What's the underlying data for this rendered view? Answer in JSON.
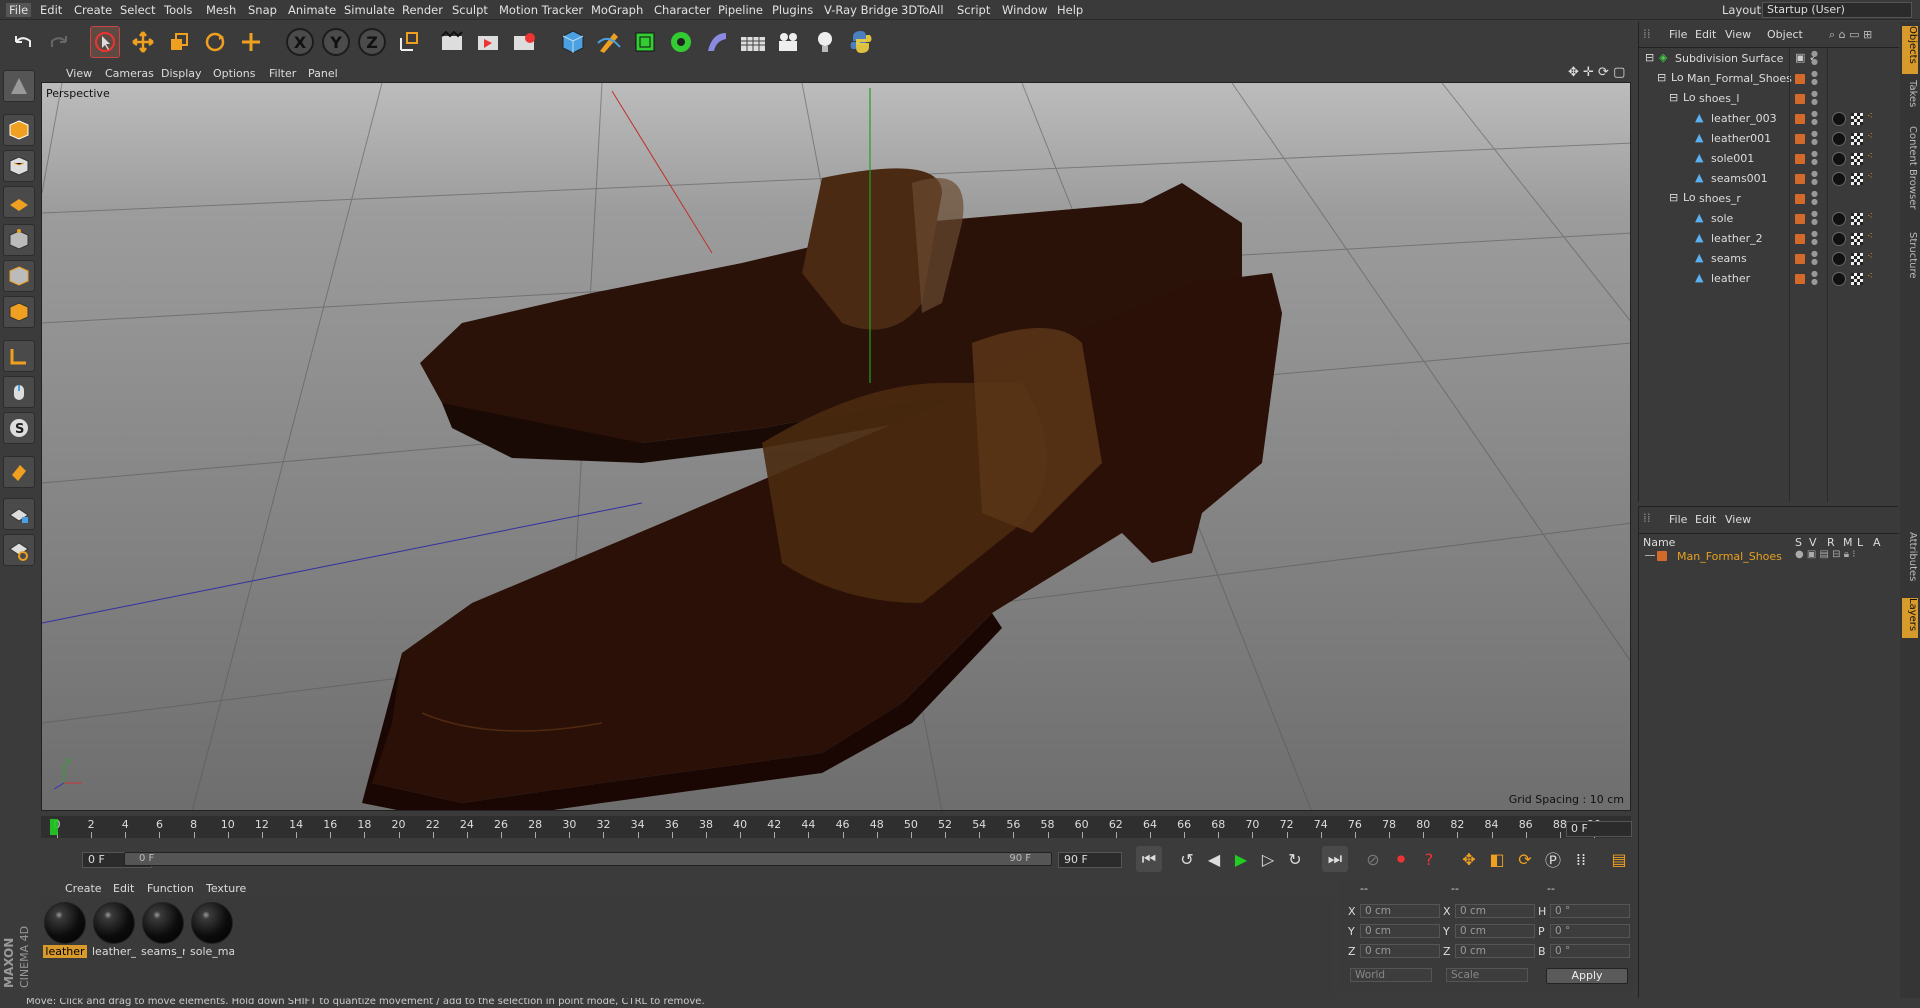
{
  "menu": {
    "items": [
      "File",
      "Edit",
      "Create",
      "Select",
      "Tools",
      "Mesh",
      "Snap",
      "Animate",
      "Simulate",
      "Render",
      "Sculpt",
      "Motion Tracker",
      "MoGraph",
      "Character",
      "Pipeline",
      "Plugins",
      "V-Ray Bridge",
      "3DToAll",
      "Script",
      "Window",
      "Help"
    ],
    "layout_label": "Layout:",
    "layout_value": "Startup (User)"
  },
  "toolbar": {
    "x_label": "X",
    "y_label": "Y",
    "z_label": "Z"
  },
  "viewport": {
    "menu": [
      "View",
      "Cameras",
      "Display",
      "Options",
      "Filter",
      "Panel"
    ],
    "label": "Perspective",
    "grid_spacing": "Grid Spacing : 10 cm",
    "axis_y": "y",
    "axis_x": "x"
  },
  "timeline": {
    "ticks": [
      "0",
      "2",
      "4",
      "6",
      "8",
      "10",
      "12",
      "14",
      "16",
      "18",
      "20",
      "22",
      "24",
      "26",
      "28",
      "30",
      "32",
      "34",
      "36",
      "38",
      "40",
      "42",
      "44",
      "46",
      "48",
      "50",
      "52",
      "54",
      "56",
      "58",
      "60",
      "62",
      "64",
      "66",
      "68",
      "70",
      "72",
      "74",
      "76",
      "78",
      "80",
      "82",
      "84",
      "86",
      "88",
      "90"
    ],
    "end_frame": "0 F"
  },
  "transport": {
    "current_frame": "0 F",
    "slider_start": "0 F",
    "slider_end": "90 F",
    "max_frame": "90 F"
  },
  "materials": {
    "menu": [
      "Create",
      "Edit",
      "Function",
      "Texture"
    ],
    "items": [
      {
        "name": "leather",
        "selected": true
      },
      {
        "name": "leather_",
        "selected": false
      },
      {
        "name": "seams_n",
        "selected": false
      },
      {
        "name": "sole_ma",
        "selected": false
      }
    ]
  },
  "coords": {
    "header_a": "--",
    "header_b": "--",
    "header_c": "--",
    "rows": [
      {
        "a": "X",
        "av": "0 cm",
        "b": "X",
        "bv": "0 cm",
        "c": "H",
        "cv": "0 °"
      },
      {
        "a": "Y",
        "av": "0 cm",
        "b": "Y",
        "bv": "0 cm",
        "c": "P",
        "cv": "0 °"
      },
      {
        "a": "Z",
        "av": "0 cm",
        "b": "Z",
        "bv": "0 cm",
        "c": "B",
        "cv": "0 °"
      }
    ],
    "world": "World",
    "scale": "Scale",
    "apply": "Apply"
  },
  "objects": {
    "menu": [
      "File",
      "Edit",
      "View",
      "Object"
    ],
    "tree": [
      {
        "name": "Subdivision Surface",
        "indent": 0,
        "tags": false
      },
      {
        "name": "Man_Formal_Shoes",
        "indent": 1,
        "tags": false
      },
      {
        "name": "shoes_l",
        "indent": 2,
        "tags": false
      },
      {
        "name": "leather_003",
        "indent": 3,
        "tags": true
      },
      {
        "name": "leather001",
        "indent": 3,
        "tags": true
      },
      {
        "name": "sole001",
        "indent": 3,
        "tags": true
      },
      {
        "name": "seams001",
        "indent": 3,
        "tags": true
      },
      {
        "name": "shoes_r",
        "indent": 2,
        "tags": false
      },
      {
        "name": "sole",
        "indent": 3,
        "tags": true
      },
      {
        "name": "leather_2",
        "indent": 3,
        "tags": true
      },
      {
        "name": "seams",
        "indent": 3,
        "tags": true
      },
      {
        "name": "leather",
        "indent": 3,
        "tags": true
      }
    ]
  },
  "layers": {
    "menu": [
      "File",
      "Edit",
      "View"
    ],
    "col_name": "Name",
    "cols": [
      "S",
      "V",
      "R",
      "M",
      "L",
      "A"
    ],
    "items": [
      "Man_Formal_Shoes"
    ]
  },
  "sidetabs": [
    "Objects",
    "Takes",
    "Content Browser",
    "Structure",
    "Attributes",
    "Layers"
  ],
  "status": "Move: Click and drag to move elements. Hold down SHIFT to quantize movement / add to the selection in point mode, CTRL to remove.",
  "brand": {
    "maxon": "MAXON",
    "cinema": "CINEMA 4D"
  },
  "colors": {
    "accent": "#d89a2a",
    "object_dot": "#d46a2a"
  }
}
